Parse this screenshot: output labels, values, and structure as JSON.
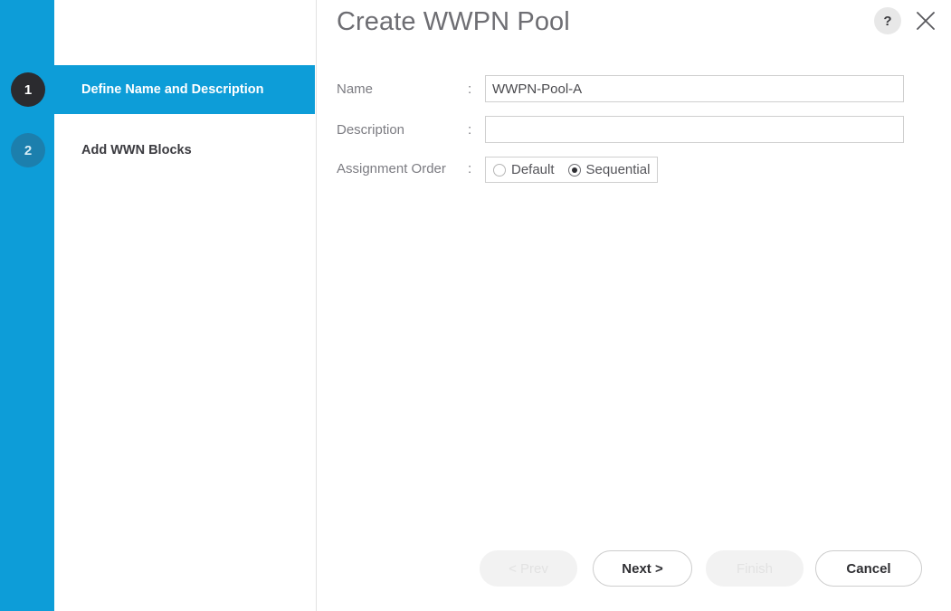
{
  "dialog": {
    "title": "Create WWPN Pool",
    "help_icon": "question-mark-icon",
    "help_label": "?",
    "close_icon": "close-icon"
  },
  "wizard": {
    "steps": [
      {
        "number": "1",
        "label": "Define Name and Description",
        "state": "active"
      },
      {
        "number": "2",
        "label": "Add WWN Blocks",
        "state": "inactive"
      }
    ]
  },
  "form": {
    "colon": ":",
    "name": {
      "label": "Name",
      "value": "WWPN-Pool-A",
      "placeholder": ""
    },
    "description": {
      "label": "Description",
      "value": "",
      "placeholder": ""
    },
    "assignment_order": {
      "label": "Assignment Order",
      "selected": "Sequential",
      "options": [
        {
          "label": "Default",
          "selected": false
        },
        {
          "label": "Sequential",
          "selected": true
        }
      ]
    }
  },
  "footer": {
    "prev_label": "< Prev",
    "next_label": "Next >",
    "finish_label": "Finish",
    "cancel_label": "Cancel"
  },
  "colors": {
    "accent_blue": "#0d9dd8",
    "rail_inactive_circle": "#1c7fad",
    "active_circle": "#2b2b2f",
    "title_gray": "#6e6e73",
    "label_gray": "#7c7c82",
    "input_border": "#cfcfcf",
    "disabled_button_bg": "#f2f2f2"
  }
}
